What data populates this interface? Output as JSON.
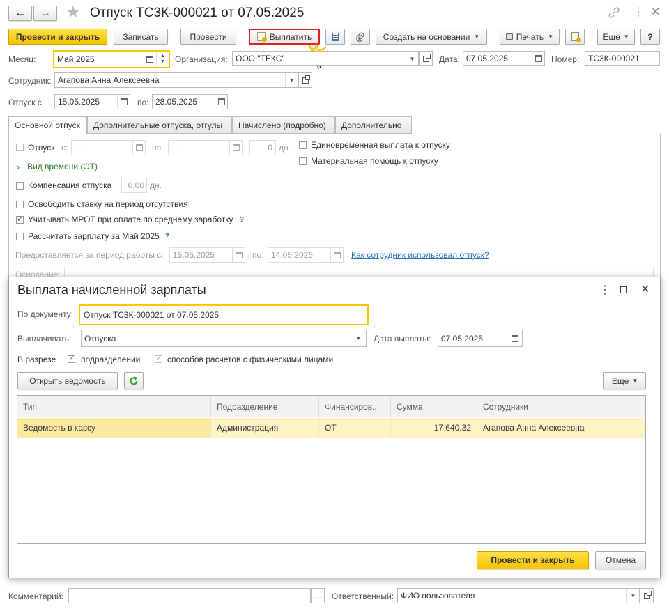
{
  "window": {
    "title": "Отпуск ТС3К-000021 от 07.05.2025"
  },
  "toolbar": {
    "post_close": "Провести и закрыть",
    "save": "Записать",
    "post": "Провести",
    "pay": "Выплатить",
    "create_based": "Создать на основании",
    "print": "Печать",
    "more": "Еще",
    "help": "?"
  },
  "header": {
    "month_label": "Месяц:",
    "month_value": "Май 2025",
    "org_label": "Организация:",
    "org_value": "ООО \"ТЕКС\"",
    "date_label": "Дата:",
    "date_value": "07.05.2025",
    "number_label": "Номер:",
    "number_value": "ТС3К-000021",
    "employee_label": "Сотрудник:",
    "employee_value": "Агапова Анна Алексеевна",
    "vacation_from_label": "Отпуск с:",
    "vacation_from_value": "15.05.2025",
    "vacation_to_label": "по:",
    "vacation_to_value": "28.05.2025"
  },
  "tabs": [
    {
      "label": "Основной отпуск"
    },
    {
      "label": "Дополнительные отпуска, отгулы"
    },
    {
      "label": "Начислено (подробно)"
    },
    {
      "label": "Дополнительно"
    }
  ],
  "main_tab": {
    "vacation_label": "Отпуск",
    "from_label": "с:",
    "from_value": " .  .",
    "to_label": "по:",
    "to_value": " .  .",
    "days_value": "0",
    "days_unit": "дн.",
    "lump_sum": "Единовременная выплата к отпуску",
    "material_aid": "Материальная помощь к отпуску",
    "time_type": "Вид времени (ОТ)",
    "compensation_label": "Компенсация отпуска",
    "compensation_value": "0,00",
    "compensation_unit": "дн.",
    "release_rate": "Освободить ставку на период отсутствия",
    "mrot": "Учитывать МРОТ при оплате по среднему заработку",
    "calc_salary": "Рассчитать зарплату за Май 2025",
    "period_label": "Предоставляется за период работы с:",
    "period_from": "15.05.2025",
    "period_to_label": "по:",
    "period_to": "14.05.2026",
    "link": "Как сотрудник использовал отпуск?",
    "hidden_label": "Основание:"
  },
  "footer": {
    "comment_label": "Комментарий:",
    "comment_value": "",
    "ellipsis": "...",
    "responsible_label": "Ответственный:",
    "responsible_value": "ФИО пользователя"
  },
  "dialog": {
    "title": "Выплата начисленной зарплаты",
    "doc_label": "По документу:",
    "doc_value": "Отпуск ТС3К-000021 от 07.05.2025",
    "pay_label": "Выплачивать:",
    "pay_value": "Отпуска",
    "pay_date_label": "Дата выплаты:",
    "pay_date_value": "07.05.2025",
    "breakdown_label": "В разрезе",
    "departments": "подразделений",
    "calc_methods": "способов расчетов с физическими лицами",
    "open_statement": "Открыть ведомость",
    "more": "Еще",
    "columns": [
      "Тип",
      "Подразделение",
      "Финансиров...",
      "Сумма",
      "Сотрудники"
    ],
    "rows": [
      {
        "type": "Ведомость в кассу",
        "department": "Администрация",
        "financing": "ОТ",
        "amount": "17 640,32",
        "employees": "Агапова Анна Алексеевна"
      }
    ],
    "post_close": "Провести и закрыть",
    "cancel": "Отмена"
  },
  "colors": {
    "accent": "#f5c400",
    "highlight_row": "#fdf3c4",
    "highlight_cell": "#fbe9a0",
    "pay_button_border": "#e02020",
    "link": "#2a6fbf",
    "green": "#2a7d2a"
  }
}
